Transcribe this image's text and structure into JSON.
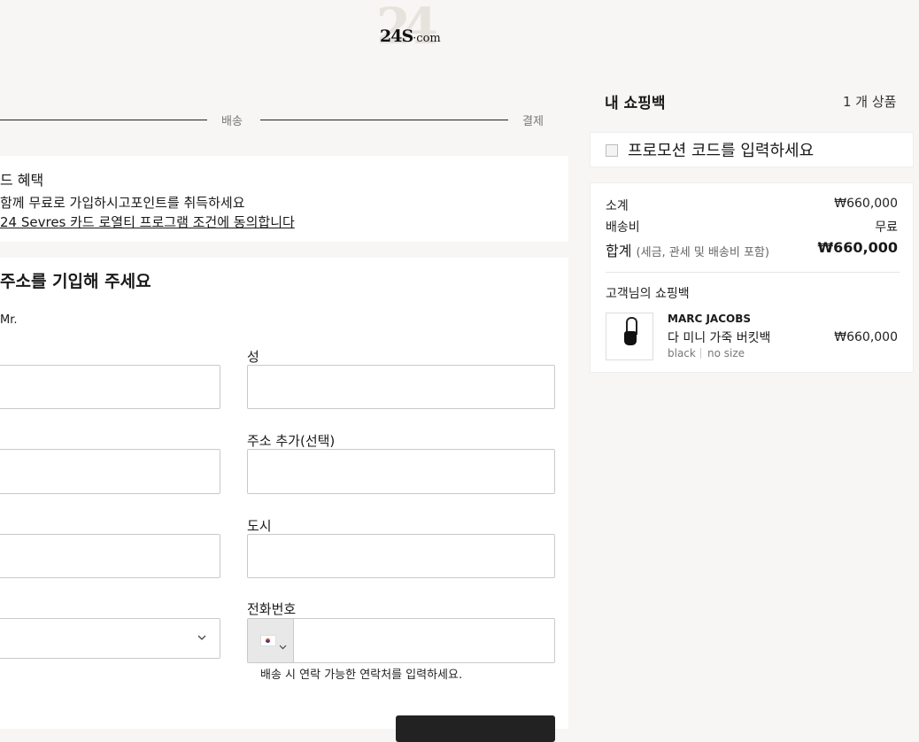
{
  "logo": {
    "text": "24S",
    "suffix": "·com"
  },
  "steps": {
    "shipping": "배송",
    "payment": "결제"
  },
  "loyalty": {
    "title": "드 혜택",
    "text": "함께 무료로 가입하시고포인트를 취득하세요",
    "link": "24 Sevres 카드 로열티 프로그램 조건에 동의합니다"
  },
  "address": {
    "title": "주소를 기입해 주세요",
    "civility": "Mr.",
    "last_name_label": "성",
    "address2_label": "주소 추가(선택)",
    "city_label": "도시",
    "phone_label": "전화번호",
    "phone_hint": "배송 시 연락 가능한 연락처를 입력하세요.",
    "country_code_icon": "kr-flag-icon"
  },
  "bag": {
    "title": "내 쇼핑백",
    "count": "1 개 상품",
    "promo_label": "프로모션 코드를 입력하세요",
    "subtotal_label": "소계",
    "subtotal_value": "₩660,000",
    "shipping_label": "배송비",
    "shipping_value": "무료",
    "total_label": "합계",
    "total_note": "(세금, 관세 및 배송비 포함)",
    "total_value": "₩660,000",
    "customer_bag_label": "고객님의 쇼핑백",
    "item": {
      "brand": "MARC JACOBS",
      "name": "다 미니 가죽 버킷백",
      "color": "black",
      "size": "no size",
      "price": "₩660,000"
    }
  }
}
